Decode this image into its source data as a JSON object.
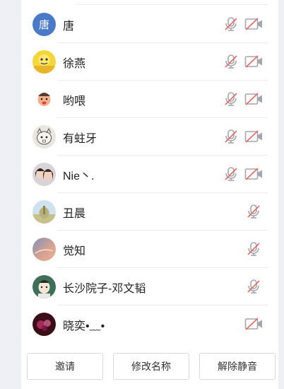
{
  "members": [
    {
      "name": "唐",
      "avatar_text": "唐",
      "avatar_color": "#4a79c8",
      "muted_mic": true,
      "camera_off": true
    },
    {
      "name": "徐燕",
      "avatar_icon": "yellow-character-avatar",
      "muted_mic": true,
      "camera_off": true
    },
    {
      "name": "哟喂",
      "avatar_icon": "cartoon-face-avatar",
      "muted_mic": true,
      "camera_off": true
    },
    {
      "name": "有蛀牙",
      "avatar_icon": "sketch-animal-avatar",
      "muted_mic": true,
      "camera_off": true
    },
    {
      "name": "Nie丶.",
      "avatar_icon": "couple-photo-avatar",
      "muted_mic": true,
      "camera_off": true
    },
    {
      "name": "丑晨",
      "avatar_icon": "landscape-photo-avatar",
      "muted_mic": true,
      "camera_off": false
    },
    {
      "name": "觉知",
      "avatar_icon": "sunset-photo-avatar",
      "muted_mic": true,
      "camera_off": false
    },
    {
      "name": "长沙院子-邓文韬",
      "avatar_icon": "anime-character-avatar",
      "muted_mic": true,
      "camera_off": false
    },
    {
      "name": "晓奕•﹏•",
      "avatar_icon": "bokeh-photo-avatar",
      "muted_mic": false,
      "camera_off": true
    }
  ],
  "actions": {
    "invite": "邀请",
    "rename": "修改名称",
    "unmute_all": "解除静音"
  },
  "colors": {
    "icon_gray": "#a3a6ae",
    "slash_red": "#e46b63"
  }
}
